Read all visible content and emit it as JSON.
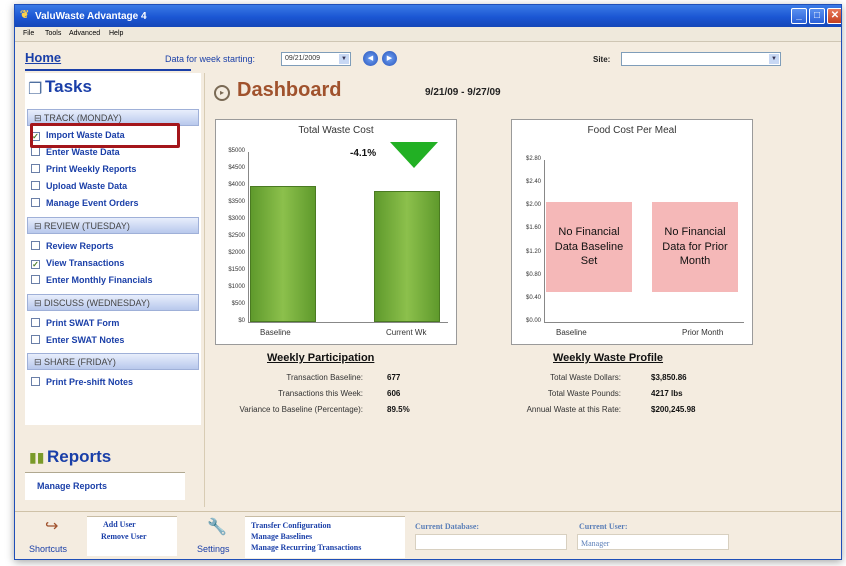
{
  "window": {
    "title": "ValuWaste Advantage 4",
    "menu": [
      "File",
      "Tools",
      "Advanced",
      "Help"
    ]
  },
  "toolbar": {
    "home_label": "Home",
    "week_label": "Data for week starting:",
    "week_value": "09/21/2009",
    "site_label": "Site:",
    "site_value": ""
  },
  "tasks": {
    "title": "Tasks",
    "sections": [
      {
        "label": "TRACK (MONDAY)",
        "items": [
          {
            "label": "Import Waste Data",
            "checked": true
          },
          {
            "label": "Enter Waste Data",
            "checked": false
          },
          {
            "label": "Print Weekly Reports",
            "checked": false
          },
          {
            "label": "Upload Waste Data",
            "checked": false
          },
          {
            "label": "Manage Event Orders",
            "checked": false
          }
        ]
      },
      {
        "label": "REVIEW (TUESDAY)",
        "items": [
          {
            "label": "Review Reports",
            "checked": false
          },
          {
            "label": "View Transactions",
            "checked": true
          },
          {
            "label": "Enter Monthly Financials",
            "checked": false
          }
        ]
      },
      {
        "label": "DISCUSS (WEDNESDAY)",
        "items": [
          {
            "label": "Print SWAT Form",
            "checked": false
          },
          {
            "label": "Enter SWAT Notes",
            "checked": false
          }
        ]
      },
      {
        "label": "SHARE (FRIDAY)",
        "items": [
          {
            "label": "Print Pre-shift Notes",
            "checked": false
          }
        ]
      }
    ]
  },
  "reports": {
    "title": "Reports",
    "manage_label": "Manage Reports"
  },
  "dashboard": {
    "title": "Dashboard",
    "date_range": "9/21/09 - 9/27/09"
  },
  "chart_data": [
    {
      "type": "bar",
      "title": "Total Waste Cost",
      "categories": [
        "Baseline",
        "Current Wk"
      ],
      "values": [
        4000,
        3840
      ],
      "ylim": [
        0,
        5000
      ],
      "yticks": [
        "$5000",
        "$4500",
        "$4000",
        "$3500",
        "$3000",
        "$2500",
        "$2000",
        "$1500",
        "$1000",
        "$500",
        "$0"
      ],
      "annotation": "-4.1%",
      "trend": "down",
      "trend_color": "#22b024"
    },
    {
      "type": "bar",
      "title": "Food Cost Per Meal",
      "categories": [
        "Baseline",
        "Prior Month"
      ],
      "values": [
        null,
        null
      ],
      "ylim": [
        0,
        2.8
      ],
      "yticks": [
        "$2.80",
        "$2.40",
        "$2.00",
        "$1.60",
        "$1.20",
        "$0.80",
        "$0.40",
        "$0.00"
      ],
      "no_data": [
        "No Financial Data Baseline Set",
        "No Financial Data for Prior Month"
      ]
    }
  ],
  "participation": {
    "title": "Weekly Participation",
    "rows": [
      {
        "label": "Transaction Baseline:",
        "value": "677"
      },
      {
        "label": "Transactions this Week:",
        "value": "606"
      },
      {
        "label": "Variance to Baseline (Percentage):",
        "value": "89.5%"
      }
    ]
  },
  "waste_profile": {
    "title": "Weekly Waste Profile",
    "rows": [
      {
        "label": "Total Waste Dollars:",
        "value": "$3,850.86"
      },
      {
        "label": "Total Waste Pounds:",
        "value": "4217 lbs"
      },
      {
        "label": "Annual Waste at this Rate:",
        "value": "$200,245.98"
      }
    ]
  },
  "bottom": {
    "shortcuts_label": "Shortcuts",
    "shortcut_links": [
      "Add User",
      "Remove User"
    ],
    "settings_label": "Settings",
    "settings_links": [
      "Transfer Configuration",
      "Manage Baselines",
      "Manage Recurring Transactions"
    ],
    "db_label": "Current Database:",
    "user_label": "Current User:",
    "user_value": "Manager"
  },
  "colors": {
    "accent": "#1a3fa8",
    "dashboard_title": "#a0522d",
    "bar": "#7cb342",
    "no_data": "#f5b8b8",
    "highlight": "#a4161b"
  }
}
